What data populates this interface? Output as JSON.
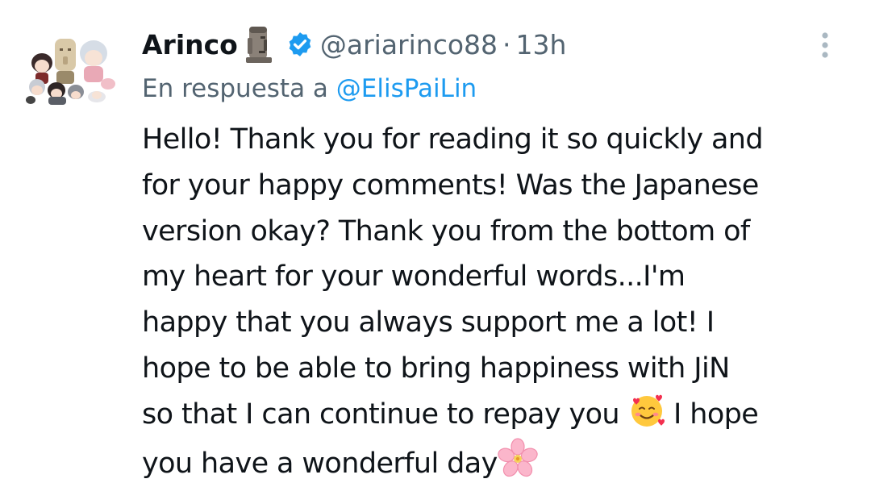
{
  "tweet": {
    "author_name": "Arinco",
    "author_emoji_icon": "moai-icon",
    "verified_icon": "verified-badge-icon",
    "handle": "@ariarinco88",
    "separator": "·",
    "timestamp": "13h",
    "reply_prefix": "En respuesta a",
    "reply_mention": "@ElisPaiLin",
    "body_lines": [
      "Hello! Thank you for reading it so quickly and",
      "for your happy comments! Was the Japanese",
      "version okay? Thank you from the bottom of",
      "my heart for your wonderful words...I'm",
      "happy that you always support me a lot! I",
      "hope to be able to bring happiness with JiN",
      "so that I can continue to repay you",
      "I hope",
      "you have a wonderful day"
    ],
    "inline_emojis": [
      "smiling-face-with-hearts-icon",
      "cherry-blossom-icon"
    ],
    "more_icon": "more-vertical-icon"
  },
  "colors": {
    "text_primary": "#0f1419",
    "text_secondary": "#536471",
    "accent": "#1d9bf0",
    "background": "#ffffff"
  }
}
